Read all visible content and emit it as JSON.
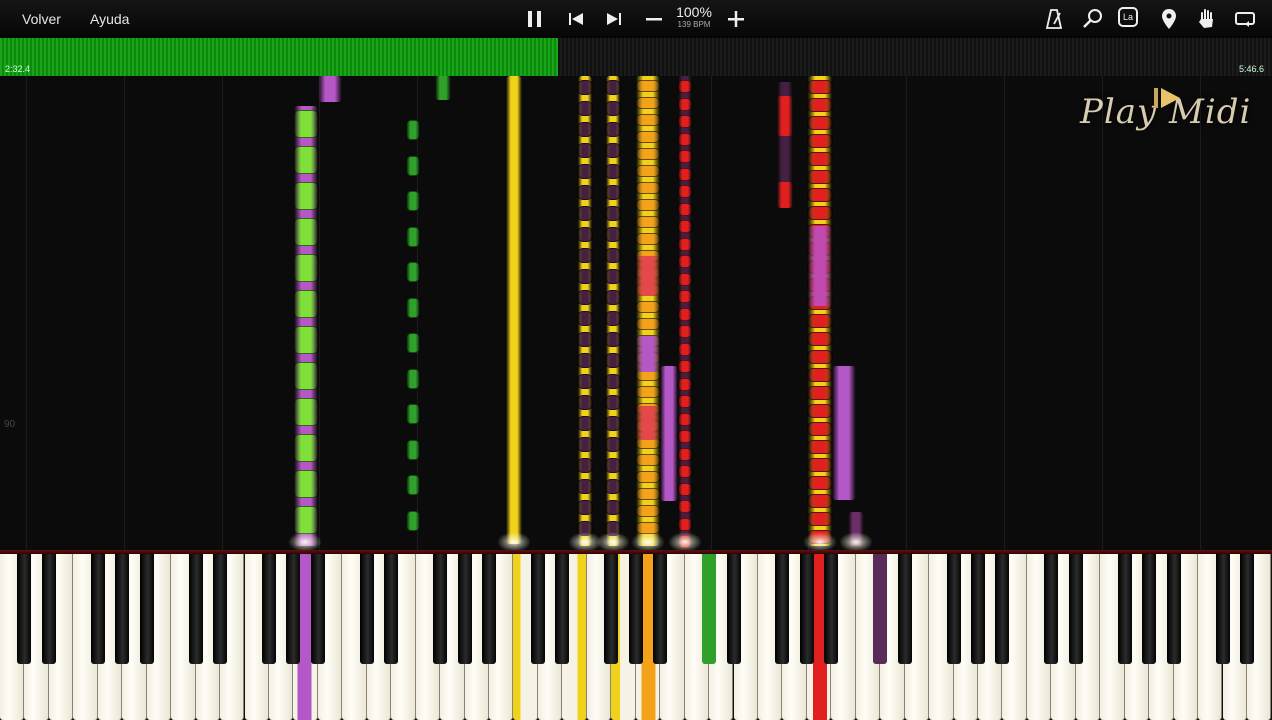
{
  "menu": {
    "back": "Volver",
    "help": "Ayuda"
  },
  "transport": {
    "zoom": "100%",
    "bpm": "139 BPM"
  },
  "toolbar_icons": [
    "pause-icon",
    "previous-icon",
    "next-icon",
    "minus-icon",
    "plus-icon",
    "metronome-icon",
    "search-icon",
    "label-la-icon",
    "location-pin-icon",
    "hand-icon",
    "loop-icon"
  ],
  "label_badge": "La",
  "progress": {
    "current": "2:32.4",
    "total": "5:46.6",
    "fraction": 0.439
  },
  "roll": {
    "octave_marker": "90"
  },
  "watermark": {
    "text": "Play Midi"
  },
  "colors": {
    "green": "#7fe03a",
    "purple": "#b457c7",
    "yellow": "#f1d21a",
    "orange": "#f4a21a",
    "red": "#e0201e",
    "darkpurple": "#452043",
    "darkgreen": "#2fa02a",
    "bg": "#0b0b0b"
  },
  "active_keys": [
    {
      "key": "white",
      "color": "purple"
    },
    {
      "key": "white",
      "color": "yellow"
    },
    {
      "key": "white",
      "color": "yellow"
    },
    {
      "key": "white",
      "color": "yellow"
    },
    {
      "key": "white",
      "color": "orange"
    },
    {
      "key": "black",
      "color": "darkgreen"
    },
    {
      "key": "white",
      "color": "red"
    },
    {
      "key": "black",
      "color": "darkpurple"
    }
  ]
}
